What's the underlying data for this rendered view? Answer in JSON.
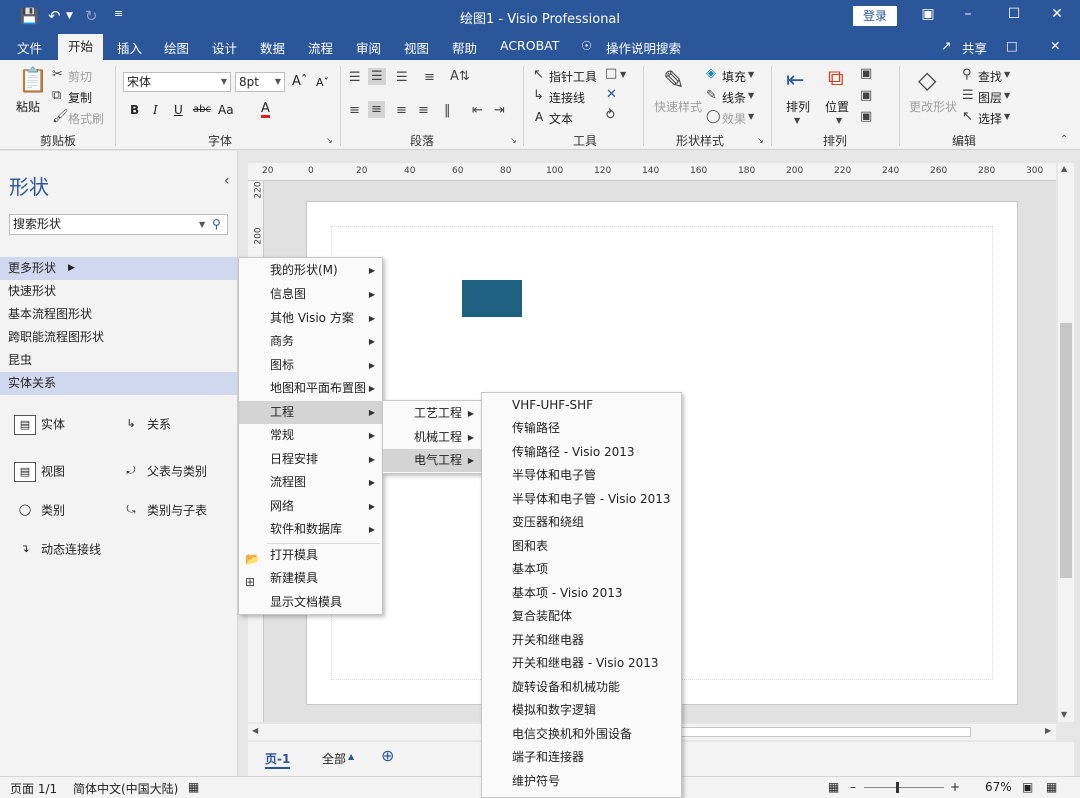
{
  "titlebar": {
    "title": "绘图1 - Visio Professional",
    "login": "登录",
    "icons": [
      "save-icon",
      "undo-icon",
      "redo-icon",
      "customize-icon"
    ]
  },
  "menubar": {
    "file": "文件",
    "home": "开始",
    "insert": "插入",
    "draw": "绘图",
    "design": "设计",
    "data": "数据",
    "process": "流程",
    "review": "审阅",
    "view": "视图",
    "help": "帮助",
    "acrobat": "ACROBAT",
    "tellme": "操作说明搜索",
    "share": "共享"
  },
  "ribbon": {
    "clipboard": {
      "paste": "粘贴",
      "cut": "剪切",
      "copy": "复制",
      "format_painter": "格式刷",
      "label": "剪贴板"
    },
    "font": {
      "font_name": "宋体",
      "font_size": "8pt",
      "bold": "B",
      "italic": "I",
      "underline": "U",
      "strike": "abc",
      "case": "Aa",
      "color": "A",
      "label": "字体"
    },
    "paragraph": {
      "label": "段落"
    },
    "tools": {
      "pointer": "指针工具",
      "connector": "连接线",
      "text": "文本",
      "label": "工具"
    },
    "shape_style": {
      "quick_styles": "快速样式",
      "fill": "填充",
      "line": "线条",
      "effects": "效果",
      "label": "形状样式"
    },
    "arrange": {
      "align": "排列",
      "position": "位置",
      "label": "排列"
    },
    "editing": {
      "change_shape": "更改形状",
      "find": "查找",
      "layers": "图层",
      "select": "选择",
      "label": "编辑"
    }
  },
  "shapes_pane": {
    "title": "形状",
    "search_placeholder": "搜索形状",
    "items": [
      "更多形状",
      "快速形状",
      "基本流程图形状",
      "跨职能流程图形状",
      "昆虫",
      "实体关系"
    ],
    "stencils": [
      "实体",
      "关系",
      "视图",
      "父表与类别",
      "类别",
      "类别与子表",
      "动态连接线"
    ]
  },
  "ruler": {
    "top": [
      "20",
      "0",
      "20",
      "40",
      "60",
      "80",
      "100",
      "120",
      "140",
      "160",
      "180",
      "200",
      "220",
      "240",
      "260",
      "280",
      "300"
    ],
    "left": [
      "220",
      "200"
    ]
  },
  "menu1": {
    "items": [
      "我的形状(M)",
      "信息图",
      "其他 Visio 方案",
      "商务",
      "图标",
      "地图和平面布置图",
      "工程",
      "常规",
      "日程安排",
      "流程图",
      "网络",
      "软件和数据库"
    ],
    "actions": [
      "打开模具",
      "新建模具",
      "显示文档模具"
    ]
  },
  "menu2": {
    "items": [
      "工艺工程",
      "机械工程",
      "电气工程"
    ]
  },
  "menu3": {
    "items": [
      "VHF-UHF-SHF",
      "传输路径",
      "传输路径 - Visio 2013",
      "半导体和电子管",
      "半导体和电子管 - Visio 2013",
      "变压器和绕组",
      "图和表",
      "基本项",
      "基本项 - Visio 2013",
      "复合装配体",
      "开关和继电器",
      "开关和继电器 - Visio 2013",
      "旋转设备和机械功能",
      "模拟和数字逻辑",
      "电信交换机和外围设备",
      "端子和连接器",
      "维护符号"
    ]
  },
  "page_tabs": {
    "page1": "页-1",
    "all": "全部"
  },
  "statusbar": {
    "page": "页面 1/1",
    "language": "简体中文(中国大陆)",
    "zoom": "67%"
  },
  "colors": {
    "accent": "#2b579a",
    "shape_fill": "#1f5f7f"
  }
}
